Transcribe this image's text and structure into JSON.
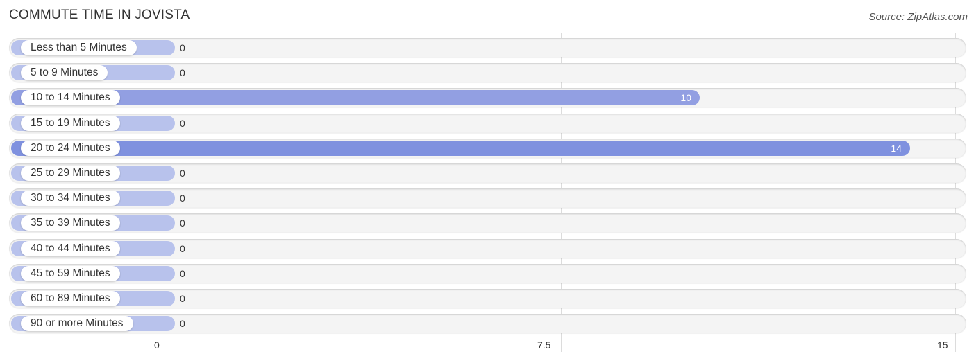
{
  "title": "COMMUTE TIME IN JOVISTA",
  "source": "Source: ZipAtlas.com",
  "colors": {
    "bar_zero": "#b8c2ec",
    "bar_mid": "#929fe2",
    "bar_max": "#7f91df",
    "track": "#f4f4f4"
  },
  "chart_data": {
    "type": "bar",
    "orientation": "horizontal",
    "title": "COMMUTE TIME IN JOVISTA",
    "xlabel": "",
    "ylabel": "",
    "xlim": [
      0,
      15
    ],
    "grid": true,
    "categories": [
      "Less than 5 Minutes",
      "5 to 9 Minutes",
      "10 to 14 Minutes",
      "15 to 19 Minutes",
      "20 to 24 Minutes",
      "25 to 29 Minutes",
      "30 to 34 Minutes",
      "35 to 39 Minutes",
      "40 to 44 Minutes",
      "45 to 59 Minutes",
      "60 to 89 Minutes",
      "90 or more Minutes"
    ],
    "values": [
      0,
      0,
      10,
      0,
      14,
      0,
      0,
      0,
      0,
      0,
      0,
      0
    ],
    "value_labels": [
      "0",
      "0",
      "10",
      "0",
      "14",
      "0",
      "0",
      "0",
      "0",
      "0",
      "0",
      "0"
    ],
    "x_ticks": [
      0,
      7.5,
      15
    ],
    "x_tick_labels": [
      "0",
      "7.5",
      "15"
    ]
  }
}
